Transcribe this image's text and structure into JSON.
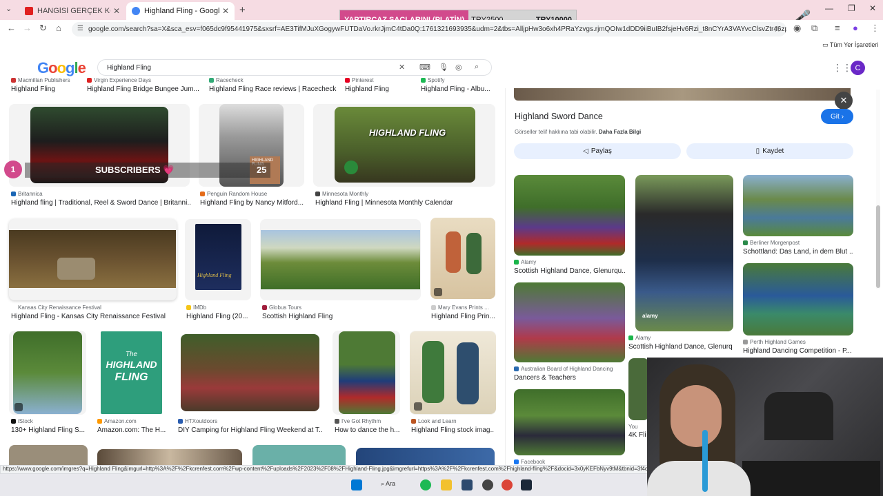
{
  "tabs": [
    {
      "title": "HANGİSİ GERÇEK KONSOMATR",
      "active": false
    },
    {
      "title": "Highland Fling - Google'da Ara",
      "active": true
    }
  ],
  "new_tab_label": "+",
  "donation": {
    "label": "YAPTIRCAZ SAÇLARINI (PLATİN)",
    "amount": "TRY2500",
    "total": "TRY10000"
  },
  "address": {
    "url": "google.com/search?sa=X&sca_esv=f065dc9f95441975&sxsrf=AE3TifMJuXGogywFUTDaVo.rkrJjmC4tDa0Q:1761321693935&udm=2&tbs=AlljpHw3o6xh4PRaYzvgs.rjmQOIw1dDD9iiBuIB2fsjeHv6Rzi_t8nCYrA3VAYvcClsvZtr46zps-73XVWE..."
  },
  "bookmarks_label": "Tüm Yer İşaretleri",
  "google_logo": [
    "G",
    "o",
    "o",
    "g",
    "l",
    "e"
  ],
  "search": {
    "query": "Highland Fling"
  },
  "avatar_letter": "C",
  "overlay": {
    "rank": "1",
    "label": "SUBSCRIBERS 💗",
    "count": "25"
  },
  "results_top": [
    {
      "source": "Macmillan Publishers",
      "caption": "Highland Fling"
    },
    {
      "source": "Virgin Experience Days",
      "caption": "Highland Fling Bridge Bungee Jum..."
    },
    {
      "source": "Racecheck",
      "caption": "Highland Fling Race reviews | Racecheck"
    },
    {
      "source": "Pinterest",
      "caption": "Highland Fling"
    },
    {
      "source": "Spotify",
      "caption": "Highland Fling - Albu..."
    }
  ],
  "results_row1": [
    {
      "source": "Britannica",
      "caption": "Highland fling | Traditional, Reel & Sword Dance | Britanni..."
    },
    {
      "source": "Penguin Random House",
      "caption": "Highland Fling by Nancy Mitford..."
    },
    {
      "source": "Minnesota Monthly",
      "caption": "Highland Fling | Minnesota Monthly Calendar"
    }
  ],
  "results_row2": [
    {
      "source": "Kansas City Renaissance Festival",
      "caption": "Highland Fling - Kansas City Renaissance Festival"
    },
    {
      "source": "IMDb",
      "caption": "Highland Fling (20..."
    },
    {
      "source": "Globus Tours",
      "caption": "Scottish Highland Fling"
    },
    {
      "source": "Mary Evans Prints ...",
      "caption": "Highland Fling Prin..."
    }
  ],
  "results_row3": [
    {
      "source": "iStock",
      "caption": "130+ Highland Fling S..."
    },
    {
      "source": "Amazon.com",
      "caption": "Amazon.com: The H..."
    },
    {
      "source": "HTXoutdoors",
      "caption": "DIY Camping for Highland Fling Weekend at T..."
    },
    {
      "source": "I've Got Rhythm",
      "caption": "How to dance the h..."
    },
    {
      "source": "Look and Learn",
      "caption": "Highland Fling stock imag..."
    }
  ],
  "image_texts": {
    "book_title": "HIGHLAND FLING",
    "amazon_line1": "The",
    "amazon_line2": "HIGHLAND",
    "amazon_line3": "FLING",
    "imdb_title": "Highland Fling",
    "minnesota_text": "HIGHLAND FLING"
  },
  "panel": {
    "title": "Highland Sword Dance",
    "copyright": "Görseller telif hakkına tabi olabilir.",
    "more_info": "Daha Fazla Bilgi",
    "go_label": "Git",
    "share_label": "Paylaş",
    "save_label": "Kaydet",
    "related": [
      {
        "source": "Alamy",
        "caption": "Scottish Highland Dance, Glenurqu..."
      },
      {
        "source": "Alamy",
        "caption": "Scottish Highland Dance, Glenurq..."
      },
      {
        "source": "Berliner Morgenpost",
        "caption": "Schottland: Das Land, in dem Blut ..."
      },
      {
        "source": "Perth Highland Games",
        "caption": "Highland Dancing Competition - P..."
      },
      {
        "source": "Australian Board of Highland Dancing",
        "caption": "Dancers & Teachers"
      },
      {
        "source": "You",
        "caption": "4K Fli"
      },
      {
        "source": "Facebook",
        "caption": ""
      }
    ],
    "watermark": "alamy"
  },
  "status_url": "https://www.google.com/imgres?q=Highland Fling&imgurl=http%3A%2F%2Fkcrenfest.com%2Fwp-content%2Fuploads%2F2023%2F08%2FHighland-Fling.jpg&imgrefurl=https%3A%2F%2Fkcrenfest.com%2Fhighland-fling%2F&docid=3x0yKEFbNyv9tM&tbnid=3f4c",
  "taskbar": {
    "search_label": "Ara"
  }
}
